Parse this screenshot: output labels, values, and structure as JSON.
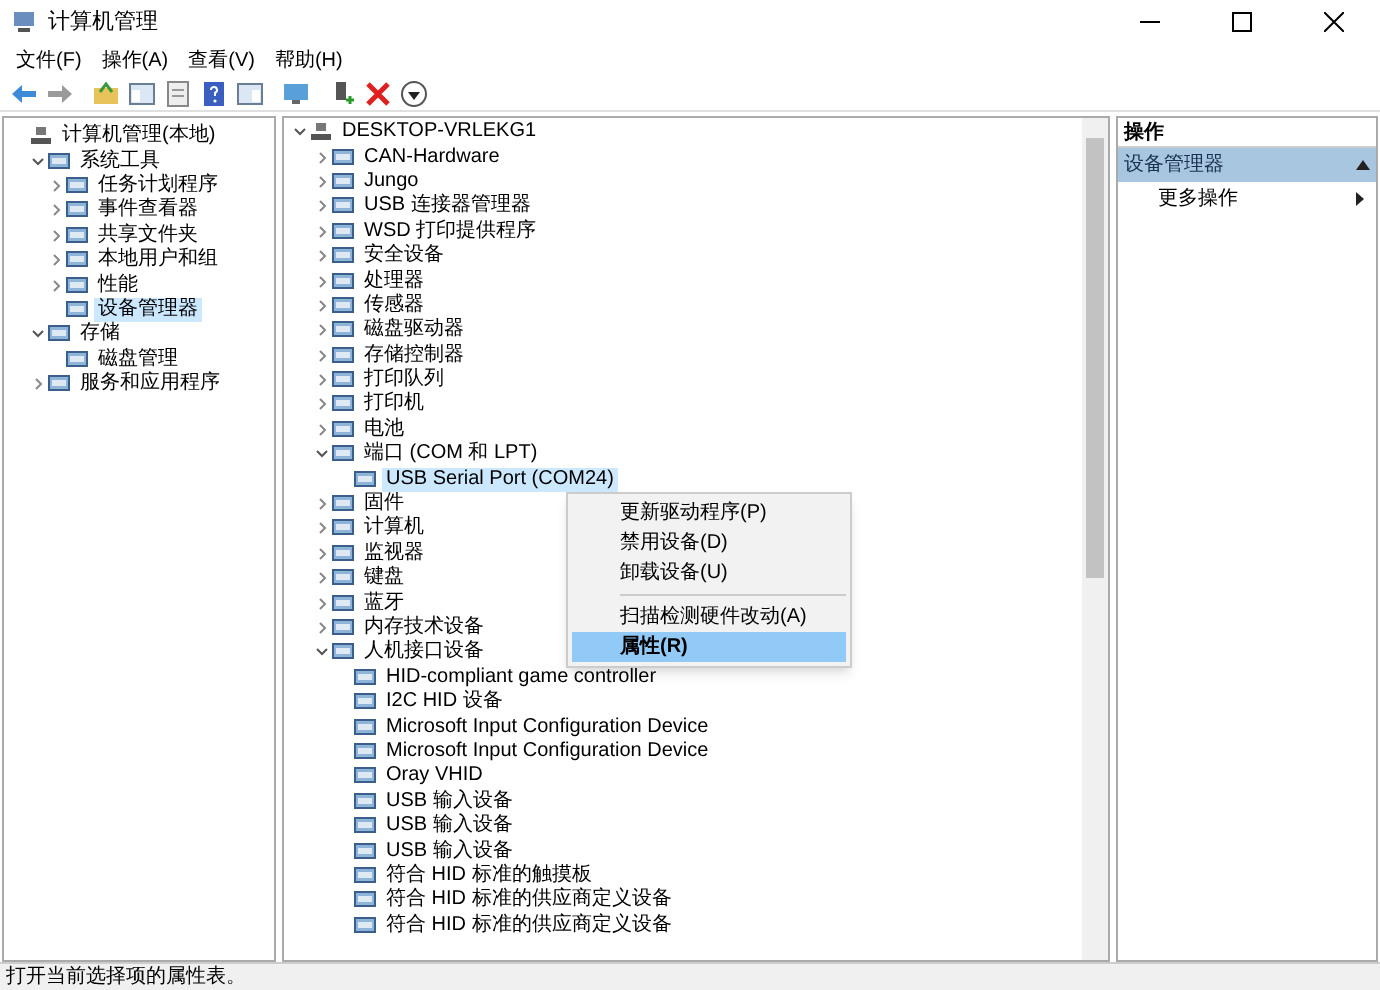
{
  "window": {
    "title": "计算机管理"
  },
  "menu": [
    "文件(F)",
    "操作(A)",
    "查看(V)",
    "帮助(H)"
  ],
  "left_tree": [
    {
      "label": "计算机管理(本地)",
      "selected": false,
      "children": [
        {
          "label": "系统工具",
          "expanded": true,
          "selected": false,
          "children": [
            {
              "label": "任务计划程序",
              "expanded": false,
              "selected": false
            },
            {
              "label": "事件查看器",
              "expanded": false,
              "selected": false
            },
            {
              "label": "共享文件夹",
              "expanded": false,
              "selected": false
            },
            {
              "label": "本地用户和组",
              "expanded": false,
              "selected": false
            },
            {
              "label": "性能",
              "expanded": false,
              "selected": false
            },
            {
              "label": "设备管理器",
              "selected": true
            }
          ]
        },
        {
          "label": "存储",
          "expanded": true,
          "selected": false,
          "children": [
            {
              "label": "磁盘管理",
              "selected": false
            }
          ]
        },
        {
          "label": "服务和应用程序",
          "expanded": false,
          "selected": false
        }
      ]
    }
  ],
  "device_tree": [
    {
      "label": "DESKTOP-VRLEKG1",
      "expanded": true,
      "selected": false,
      "children": [
        {
          "label": "CAN-Hardware",
          "expanded": false,
          "selected": false
        },
        {
          "label": "Jungo",
          "expanded": false,
          "selected": false
        },
        {
          "label": "USB 连接器管理器",
          "expanded": false,
          "selected": false
        },
        {
          "label": "WSD 打印提供程序",
          "expanded": false,
          "selected": false
        },
        {
          "label": "安全设备",
          "expanded": false,
          "selected": false
        },
        {
          "label": "处理器",
          "expanded": false,
          "selected": false
        },
        {
          "label": "传感器",
          "expanded": false,
          "selected": false
        },
        {
          "label": "磁盘驱动器",
          "expanded": false,
          "selected": false
        },
        {
          "label": "存储控制器",
          "expanded": false,
          "selected": false
        },
        {
          "label": "打印队列",
          "expanded": false,
          "selected": false
        },
        {
          "label": "打印机",
          "expanded": false,
          "selected": false
        },
        {
          "label": "电池",
          "expanded": false,
          "selected": false
        },
        {
          "label": "端口 (COM 和 LPT)",
          "expanded": true,
          "selected": false,
          "children": [
            {
              "label": "USB Serial Port (COM24)",
              "selected": true
            }
          ]
        },
        {
          "label": "固件",
          "expanded": false,
          "selected": false
        },
        {
          "label": "计算机",
          "expanded": false,
          "selected": false
        },
        {
          "label": "监视器",
          "expanded": false,
          "selected": false
        },
        {
          "label": "键盘",
          "expanded": false,
          "selected": false
        },
        {
          "label": "蓝牙",
          "expanded": false,
          "selected": false
        },
        {
          "label": "内存技术设备",
          "expanded": false,
          "selected": false
        },
        {
          "label": "人机接口设备",
          "expanded": true,
          "selected": false,
          "children": [
            {
              "label": "HID-compliant game controller",
              "selected": false
            },
            {
              "label": "I2C HID 设备",
              "selected": false
            },
            {
              "label": "Microsoft Input Configuration Device",
              "selected": false
            },
            {
              "label": "Microsoft Input Configuration Device",
              "selected": false
            },
            {
              "label": "Oray VHID",
              "selected": false
            },
            {
              "label": "USB 输入设备",
              "selected": false
            },
            {
              "label": "USB 输入设备",
              "selected": false
            },
            {
              "label": "USB 输入设备",
              "selected": false
            },
            {
              "label": "符合 HID 标准的触摸板",
              "selected": false
            },
            {
              "label": "符合 HID 标准的供应商定义设备",
              "selected": false
            },
            {
              "label": "符合 HID 标准的供应商定义设备",
              "selected": false
            }
          ]
        }
      ]
    }
  ],
  "context_menu": [
    {
      "kind": "item",
      "label": "更新驱动程序(P)",
      "selected": false
    },
    {
      "kind": "item",
      "label": "禁用设备(D)",
      "selected": false
    },
    {
      "kind": "item",
      "label": "卸载设备(U)",
      "selected": false
    },
    {
      "kind": "separator"
    },
    {
      "kind": "item",
      "label": "扫描检测硬件改动(A)",
      "selected": false
    },
    {
      "kind": "item",
      "label": "属性(R)",
      "selected": true
    }
  ],
  "actions": {
    "title": "操作",
    "section": "设备管理器",
    "items": [
      "更多操作"
    ]
  },
  "status_bar": "打开当前选择项的属性表。"
}
